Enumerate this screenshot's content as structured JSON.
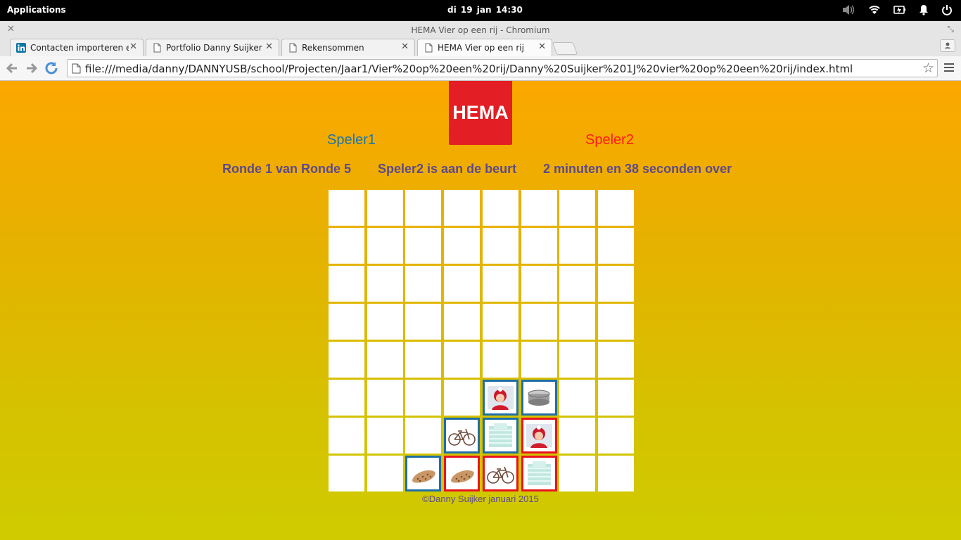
{
  "system_bar": {
    "applications_label": "Applications",
    "datetime": "di 19 jan    14:30"
  },
  "browser": {
    "window_title": "HEMA Vier op een rij - Chromium",
    "tabs": [
      {
        "label": "Contacten importeren en ui"
      },
      {
        "label": "Portfolio Danny Suijker"
      },
      {
        "label": "Rekensommen"
      },
      {
        "label": "HEMA Vier op een rij"
      }
    ],
    "url": "file:///media/danny/DANNYUSB/school/Projecten/Jaar1/Vier%20op%20een%20rij/Danny%20Suijker%201J%20vier%20op%20een%20rij/index.html"
  },
  "game": {
    "logo_text": "HEMA",
    "player1": "Speler1",
    "player2": "Speler2",
    "round": "Ronde 1 van Ronde 5",
    "turn": "Speler2 is aan de beurt",
    "time_left": "2 minuten en 38 seconden over",
    "colors": {
      "player1": "#1f6fa6",
      "player2": "#e8141e",
      "status_text": "#5b4a8b"
    },
    "board": [
      [
        "",
        "",
        "",
        "",
        "",
        "",
        "",
        ""
      ],
      [
        "",
        "",
        "",
        "",
        "",
        "",
        "",
        ""
      ],
      [
        "",
        "",
        "",
        "",
        "",
        "",
        "",
        ""
      ],
      [
        "",
        "",
        "",
        "",
        "",
        "",
        "",
        ""
      ],
      [
        "",
        "",
        "",
        "",
        "",
        "",
        "",
        ""
      ],
      [
        "",
        "",
        "",
        "",
        "blue:girl",
        "blue:tin",
        "",
        ""
      ],
      [
        "",
        "",
        "",
        "blue:bicycle",
        "blue:bedding",
        "red:girl",
        "",
        ""
      ],
      [
        "",
        "",
        "blue:sausage",
        "red:sausage",
        "red:bicycle",
        "red:bedding",
        "",
        ""
      ]
    ],
    "footer": "©Danny Suijker januari 2015"
  }
}
